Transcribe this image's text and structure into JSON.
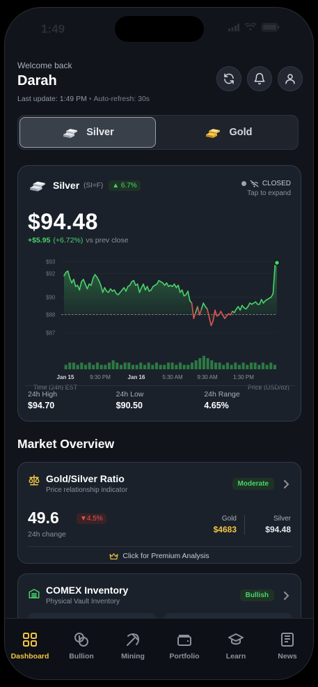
{
  "status_bar": {
    "time": "1:49"
  },
  "header": {
    "welcome": "Welcome back",
    "username": "Darah",
    "last_update": "Last update: 1:49 PM",
    "auto_refresh": "Auto-refresh: 30s"
  },
  "toggle": {
    "silver": "Silver",
    "gold": "Gold",
    "selected": "Silver"
  },
  "price_card": {
    "metal": "Silver",
    "ticker": "(SI=F)",
    "badge": "▲ 6.7%",
    "status": "CLOSED",
    "tap_hint": "Tap to expand",
    "price": "$94.48",
    "change_abs": "+$5.95",
    "change_pct": "(+6.72%)",
    "change_ref": "vs prev close",
    "time_axis_label": "Time (24h) EST",
    "price_axis_label": "Price (USD/oz)",
    "stats": [
      {
        "label": "24h High",
        "value": "$94.70"
      },
      {
        "label": "24h Low",
        "value": "$90.50"
      },
      {
        "label": "24h Range",
        "value": "4.65%"
      }
    ]
  },
  "chart_data": {
    "type": "area",
    "title": "",
    "xlabel": "Time (24h) EST",
    "ylabel": "Price (USD/oz)",
    "x_ticks": [
      "Jan 15",
      "9:30 PM",
      "Jan 16",
      "5:30 AM",
      "9:30 AM",
      "1:30 PM"
    ],
    "y_ticks": [
      "$93",
      "$92",
      "$90",
      "$88",
      "$87"
    ],
    "ylim": [
      86.5,
      93.2
    ],
    "reference_line": 88.53,
    "series": [
      {
        "values": [
          91.8,
          92.1,
          92.2,
          91.6,
          91.2,
          91.5,
          90.9,
          91.0,
          90.6,
          91.3,
          91.5,
          91.1,
          90.7,
          91.1,
          91.0,
          91.6,
          91.9,
          91.7,
          91.4,
          91.0,
          90.4,
          90.8,
          90.5,
          90.4,
          90.7,
          90.5,
          90.6,
          90.3,
          90.2,
          90.4,
          90.6,
          90.8,
          90.5,
          90.9,
          91.0,
          91.3,
          91.4,
          91.0,
          91.1,
          90.4,
          90.8,
          91.1,
          90.6,
          90.9,
          90.5,
          90.6,
          90.9,
          91.0,
          91.1,
          91.4,
          91.3,
          91.2,
          91.0,
          91.2,
          90.9,
          91.0,
          90.9,
          91.1,
          90.8,
          91.0,
          90.4,
          90.6,
          90.1,
          90.2,
          90.5,
          89.7,
          89.5,
          88.2,
          88.7,
          89.2,
          88.5,
          89.0,
          89.5,
          89.2,
          89.0,
          88.3,
          87.6,
          88.0,
          88.9,
          88.4,
          88.5,
          88.8,
          88.5,
          88.2,
          88.4,
          88.6,
          88.5,
          88.8,
          88.7,
          89.0,
          89.2,
          88.9,
          89.3,
          89.1,
          89.0,
          89.2,
          89.5,
          89.4,
          89.5,
          89.6,
          89.4,
          89.4,
          89.8,
          89.5,
          89.7,
          89.8,
          89.9,
          90.0,
          90.3,
          92.7,
          92.9
        ]
      }
    ],
    "volume": [
      2,
      3,
      3,
      2,
      3,
      2,
      3,
      2,
      3,
      2,
      2,
      3,
      4,
      3,
      2,
      3,
      3,
      2,
      2,
      3,
      2,
      3,
      2,
      3,
      2,
      2,
      3,
      3,
      2,
      3,
      2,
      2,
      3,
      4,
      5,
      6,
      5,
      4,
      3,
      3,
      2,
      3,
      2,
      3,
      2,
      3,
      2,
      3,
      3,
      2,
      3,
      2,
      3,
      2
    ]
  },
  "market_overview": {
    "title": "Market Overview",
    "ratio_card": {
      "title": "Gold/Silver Ratio",
      "subtitle": "Price relationship indicator",
      "badge": "Moderate",
      "value": "49.6",
      "change": "▼4.5%",
      "change_label": "24h change",
      "gold_label": "Gold",
      "gold_value": "$4683",
      "silver_label": "Silver",
      "silver_value": "$94.48",
      "premium": "Click for Premium Analysis"
    },
    "comex_card": {
      "title": "COMEX Inventory",
      "subtitle": "Physical Vault Inventory",
      "badge": "Bullish"
    }
  },
  "tabbar": {
    "active": "Dashboard",
    "items": [
      "Dashboard",
      "Bullion",
      "Mining",
      "Portfolio",
      "Learn",
      "News"
    ]
  },
  "colors": {
    "up": "#4ad36a",
    "down": "#e05454",
    "gold_accent": "#f2c542",
    "card_bg": "#1b212b"
  }
}
